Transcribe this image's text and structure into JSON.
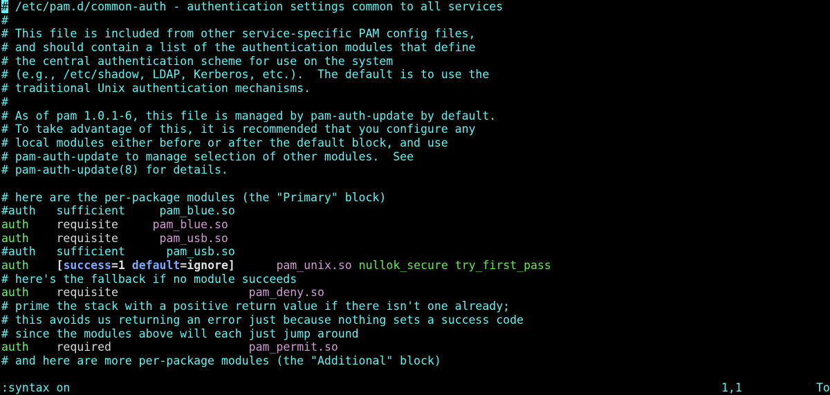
{
  "editor": {
    "cursor_char": "#",
    "lines": [
      {
        "kind": "comment",
        "text": " /etc/pam.d/common-auth - authentication settings common to all services",
        "prefix": "#"
      },
      {
        "kind": "comment",
        "text": "#"
      },
      {
        "kind": "comment",
        "text": "# This file is included from other service-specific PAM config files,"
      },
      {
        "kind": "comment",
        "text": "# and should contain a list of the authentication modules that define"
      },
      {
        "kind": "comment",
        "text": "# the central authentication scheme for use on the system"
      },
      {
        "kind": "comment",
        "text": "# (e.g., /etc/shadow, LDAP, Kerberos, etc.).  The default is to use the"
      },
      {
        "kind": "comment",
        "text": "# traditional Unix authentication mechanisms."
      },
      {
        "kind": "comment",
        "text": "#"
      },
      {
        "kind": "comment",
        "text": "# As of pam 1.0.1-6, this file is managed by pam-auth-update by default."
      },
      {
        "kind": "comment",
        "text": "# To take advantage of this, it is recommended that you configure any"
      },
      {
        "kind": "comment",
        "text": "# local modules either before or after the default block, and use"
      },
      {
        "kind": "comment",
        "text": "# pam-auth-update to manage selection of other modules.  See"
      },
      {
        "kind": "comment",
        "text": "# pam-auth-update(8) for details."
      },
      {
        "kind": "blank",
        "text": ""
      },
      {
        "kind": "comment",
        "text": "# here are the per-package modules (the \"Primary\" block)"
      },
      {
        "kind": "comment",
        "text": "#auth   sufficient     pam_blue.so"
      },
      {
        "kind": "rule",
        "type": "auth",
        "gap1": "    ",
        "control": "requisite",
        "gap2": "     ",
        "module": "pam_blue.so",
        "args": ""
      },
      {
        "kind": "rule",
        "type": "auth",
        "gap1": "    ",
        "control": "requisite",
        "gap2": "      ",
        "module": "pam_usb.so",
        "args": ""
      },
      {
        "kind": "comment",
        "text": "#auth   sufficient      pam_usb.so"
      },
      {
        "kind": "rule-bracket",
        "type": "auth",
        "gap1": "    ",
        "open": "[",
        "k1": "success",
        "eq1": "=",
        "v1": "1",
        "sp": " ",
        "k2": "default",
        "eq2": "=",
        "v2": "ignore",
        "close": "]",
        "gap2": "      ",
        "module": "pam_unix.so",
        "args": " nullok_secure try_first_pass"
      },
      {
        "kind": "comment",
        "text": "# here's the fallback if no module succeeds"
      },
      {
        "kind": "rule",
        "type": "auth",
        "gap1": "    ",
        "control": "requisite",
        "gap2": "                   ",
        "module": "pam_deny.so",
        "args": ""
      },
      {
        "kind": "comment",
        "text": "# prime the stack with a positive return value if there isn't one already;"
      },
      {
        "kind": "comment",
        "text": "# this avoids us returning an error just because nothing sets a success code"
      },
      {
        "kind": "comment",
        "text": "# since the modules above will each just jump around"
      },
      {
        "kind": "rule",
        "type": "auth",
        "gap1": "    ",
        "control": "required",
        "gap2": "                    ",
        "module": "pam_permit.so",
        "args": ""
      },
      {
        "kind": "comment",
        "text": "# and here are more per-package modules (the \"Additional\" block)"
      }
    ]
  },
  "status": {
    "command": ":syntax on",
    "ruler": "1,1",
    "position": "To"
  },
  "colors": {
    "background": "#000000",
    "comment": "#5ff5f5",
    "keyword": "#6bf26b",
    "module": "#d29ad2",
    "bracket_key": "#7fa8ff"
  }
}
